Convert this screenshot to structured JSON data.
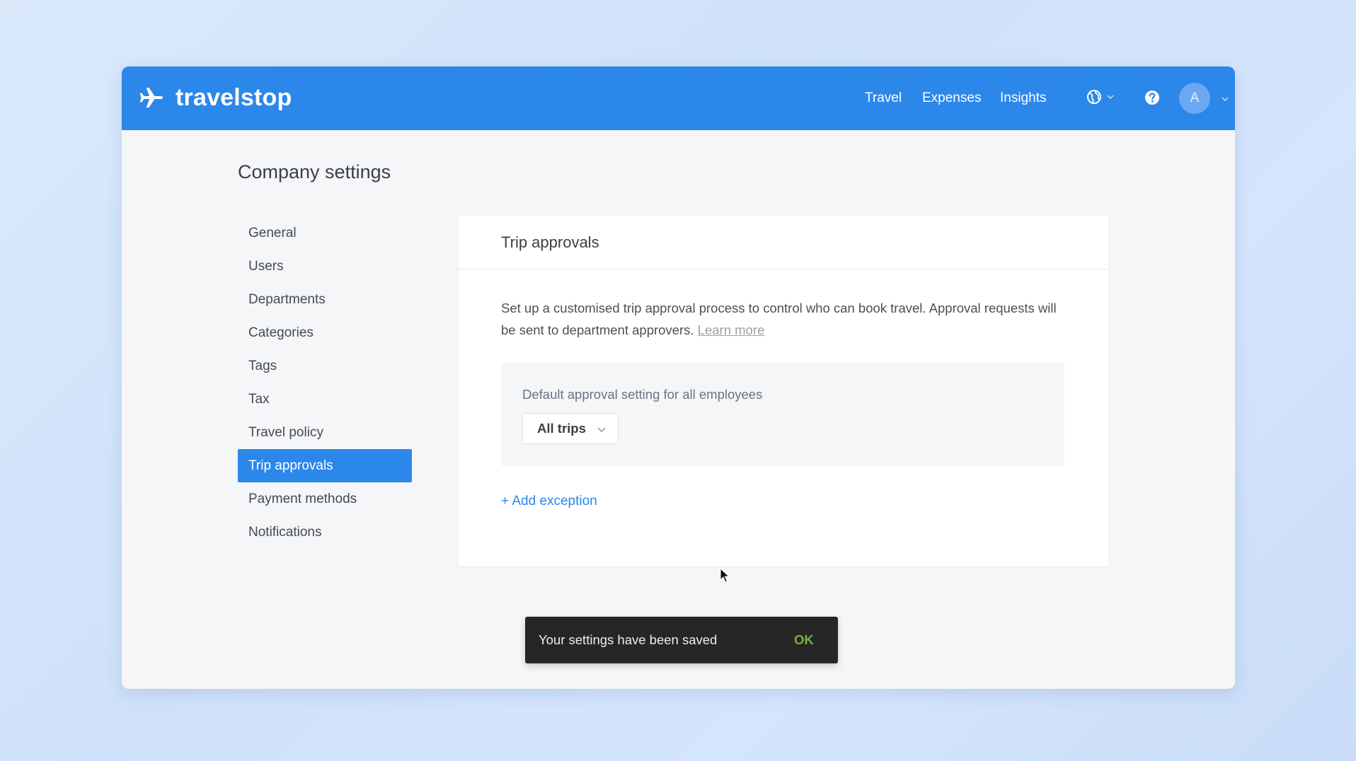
{
  "brand": {
    "name": "travelstop",
    "icon": "airplane-icon"
  },
  "nav": {
    "links": [
      "Travel",
      "Expenses",
      "Insights"
    ],
    "icons": [
      "globe-icon",
      "help-icon"
    ],
    "avatar_initial": "A"
  },
  "page": {
    "title": "Company settings"
  },
  "sidebar": {
    "items": [
      {
        "label": "General",
        "active": false
      },
      {
        "label": "Users",
        "active": false
      },
      {
        "label": "Departments",
        "active": false
      },
      {
        "label": "Categories",
        "active": false
      },
      {
        "label": "Tags",
        "active": false
      },
      {
        "label": "Tax",
        "active": false
      },
      {
        "label": "Travel policy",
        "active": false
      },
      {
        "label": "Trip approvals",
        "active": true
      },
      {
        "label": "Payment methods",
        "active": false
      },
      {
        "label": "Notifications",
        "active": false
      }
    ]
  },
  "card": {
    "title": "Trip approvals",
    "description": "Set up a customised trip approval process to control who can book travel. Approval requests will be sent to department approvers.",
    "learn_more": "Learn more",
    "default_label": "Default approval setting for all employees",
    "default_value": "All trips",
    "add_exception": "+ Add exception"
  },
  "toast": {
    "message": "Your settings have been saved",
    "action": "OK"
  },
  "colors": {
    "brand_blue": "#2b87ea",
    "toast_bg": "#262626",
    "ok_green": "#73b53c"
  }
}
